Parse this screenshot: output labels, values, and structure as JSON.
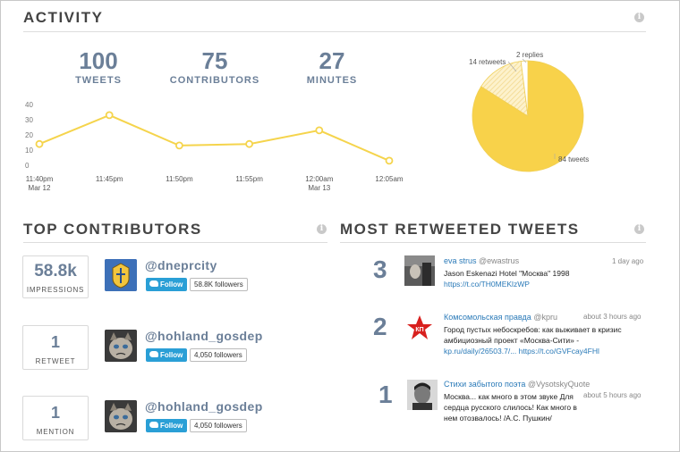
{
  "activity": {
    "title": "ACTIVITY",
    "stats": [
      {
        "value": "100",
        "label": "TWEETS"
      },
      {
        "value": "75",
        "label": "CONTRIBUTORS"
      },
      {
        "value": "27",
        "label": "MINUTES"
      }
    ]
  },
  "chart_data": [
    {
      "type": "line",
      "x": [
        "11:40pm",
        "11:45pm",
        "11:50pm",
        "11:55pm",
        "12:00am",
        "12:05am"
      ],
      "x_sublabels": [
        "Mar 12",
        "",
        "",
        "",
        "Mar 13",
        ""
      ],
      "values": [
        14,
        33,
        13,
        14,
        23,
        3
      ],
      "y_ticks": [
        "40",
        "30",
        "20",
        "10",
        "0"
      ],
      "ylim": [
        0,
        40
      ],
      "grid": false,
      "color": "#f5d44c"
    },
    {
      "type": "pie",
      "slices": [
        {
          "label": "84 tweets",
          "value": 84
        },
        {
          "label": "14 retweets",
          "value": 14
        },
        {
          "label": "2 replies",
          "value": 2
        }
      ],
      "colors": [
        "#f8d24a",
        "#fbe7a6",
        "#ffffff"
      ]
    }
  ],
  "top_contributors": {
    "title": "TOP CONTRIBUTORS",
    "items": [
      {
        "metric_value": "58.8k",
        "metric_label": "IMPRESSIONS",
        "handle": "@dneprcity",
        "follow": "Follow",
        "followers": "58.8K followers"
      },
      {
        "metric_value": "1",
        "metric_label": "RETWEET",
        "handle": "@hohland_gosdep",
        "follow": "Follow",
        "followers": "4,050 followers"
      },
      {
        "metric_value": "1",
        "metric_label": "MENTION",
        "handle": "@hohland_gosdep",
        "follow": "Follow",
        "followers": "4,050 followers"
      }
    ]
  },
  "most_retweeted": {
    "title": "MOST RETWEETED TWEETS",
    "items": [
      {
        "rank": "3",
        "name": "eva strus",
        "handle": "@ewastrus",
        "time": "1 day ago",
        "text": "Jason Eskenazi Hotel \"Москва\" 1998",
        "link": "https://t.co/TH0MEKlzWP",
        "link2": ""
      },
      {
        "rank": "2",
        "name": "Комсомольская правда",
        "handle": "@kpru",
        "time": "about 3 hours ago",
        "text": "Город пустых небоскребов: как выживает в кризис амбициозный проект «Москва-Сити» -",
        "link": "kp.ru/daily/26503.7/...",
        "link2": "https://t.co/GVFcay4FHl"
      },
      {
        "rank": "1",
        "name": "Стихи забытого поэта",
        "handle": "@VysotskyQuote",
        "time": "about 5 hours ago",
        "text": "Москва... как много в этом звуке Для сердца русского слилось! Как много в нем отозвалось! /А.С. Пушкин/",
        "link": "",
        "link2": ""
      }
    ]
  }
}
